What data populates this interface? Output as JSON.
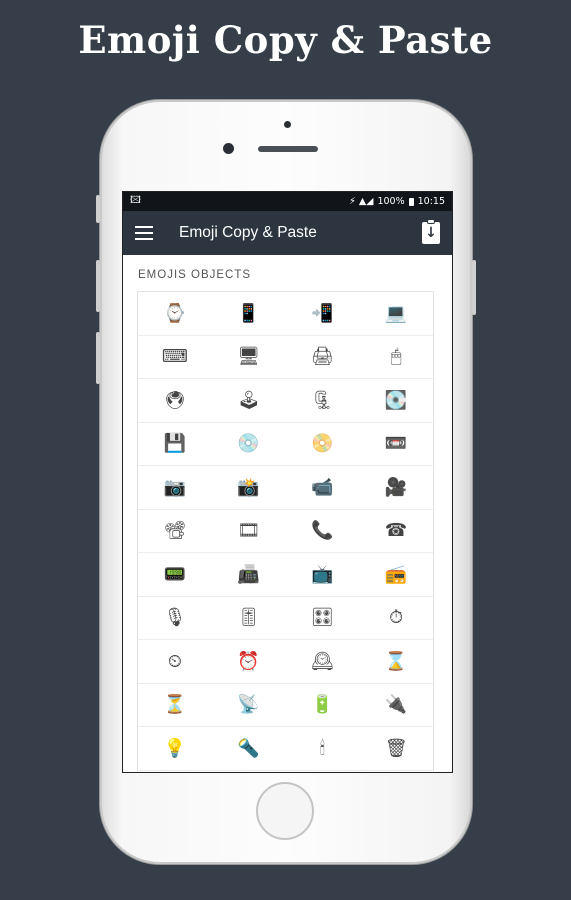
{
  "promo": {
    "title": "Emoji Copy & Paste"
  },
  "status_bar": {
    "left_icon": "🖾",
    "battery": "100%",
    "time": "10:15",
    "signal": "⚡ ▲◢"
  },
  "app_bar": {
    "title": "Emoji Copy & Paste"
  },
  "section": {
    "title": "EMOJIS OBJECTS"
  },
  "emojis": [
    "⌚",
    "📱",
    "📲",
    "💻",
    "⌨",
    "🖥",
    "🖨",
    "🖱",
    "🖲",
    "🕹",
    "🗜",
    "💽",
    "💾",
    "💿",
    "📀",
    "📼",
    "📷",
    "📸",
    "📹",
    "🎥",
    "📽",
    "🎞",
    "📞",
    "☎",
    "📟",
    "📠",
    "📺",
    "📻",
    "🎙",
    "🎚",
    "🎛",
    "⏱",
    "⏲",
    "⏰",
    "🕰",
    "⌛",
    "⏳",
    "📡",
    "🔋",
    "🔌",
    "💡",
    "🔦",
    "🕯",
    "🗑"
  ],
  "colors": {
    "background": "#363e49",
    "app_bar": "#2d3540",
    "status_bar": "#111418"
  }
}
